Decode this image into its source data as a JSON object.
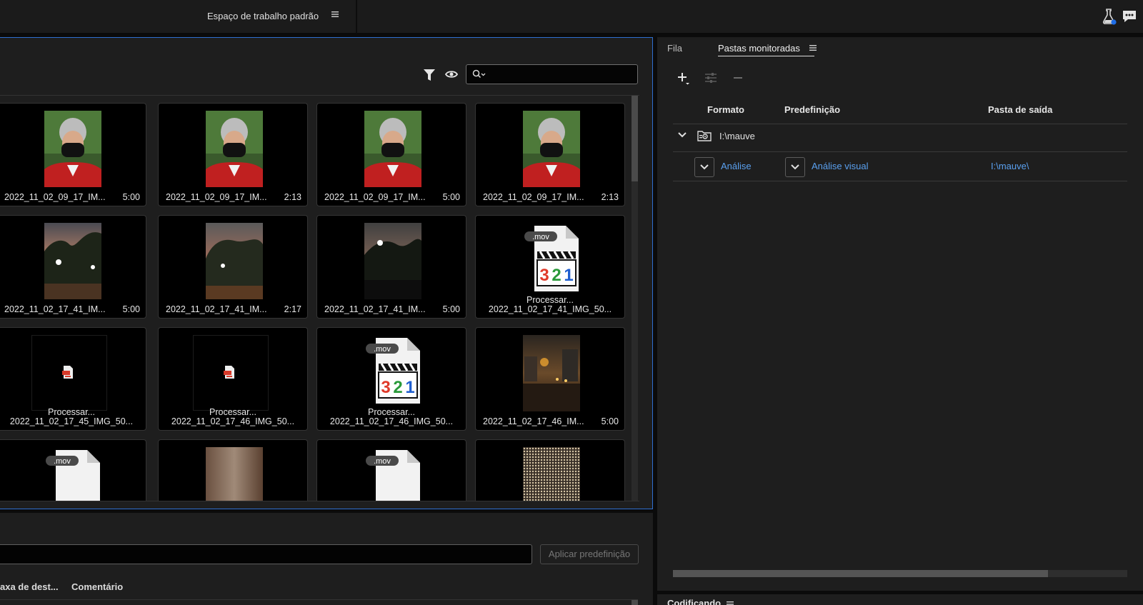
{
  "header": {
    "workspace_label": "Espaço de trabalho padrão",
    "icons": [
      "workspace-menu-icon",
      "beta-lab-icon",
      "feedback-icon"
    ]
  },
  "browser": {
    "search": {
      "value": "",
      "placeholder": ""
    },
    "tiles": [
      {
        "name": "2022_11_02_09_17_IM...",
        "duration": "5:00",
        "kind": "photo-portrait"
      },
      {
        "name": "2022_11_02_09_17_IM...",
        "duration": "2:13",
        "kind": "photo-portrait"
      },
      {
        "name": "2022_11_02_09_17_IM...",
        "duration": "5:00",
        "kind": "photo-portrait"
      },
      {
        "name": "2022_11_02_09_17_IM...",
        "duration": "2:13",
        "kind": "photo-portrait"
      },
      {
        "name": "2022_11_02_17_41_IM...",
        "duration": "5:00",
        "kind": "photo-dusk"
      },
      {
        "name": "2022_11_02_17_41_IM...",
        "duration": "2:17",
        "kind": "photo-dusk2"
      },
      {
        "name": "2022_11_02_17_41_IM...",
        "duration": "5:00",
        "kind": "photo-dusk3"
      },
      {
        "name": "2022_11_02_17_41_IMG_50...",
        "status": "Processar...",
        "kind": "mov-file",
        "ext": ".mov",
        "badge_digits": [
          "3",
          "2",
          "1"
        ]
      },
      {
        "name": "2022_11_02_17_45_IMG_50...",
        "status": "Processar...",
        "kind": "broken"
      },
      {
        "name": "2022_11_02_17_46_IMG_50...",
        "status": "Processar...",
        "kind": "broken"
      },
      {
        "name": "2022_11_02_17_46_IMG_50...",
        "status": "Processar...",
        "kind": "mov-file",
        "ext": ".mov",
        "badge_digits": [
          "3",
          "2",
          "1"
        ]
      },
      {
        "name": "2022_11_02_17_46_IM...",
        "duration": "5:00",
        "kind": "photo-night"
      },
      {
        "kind": "mov-file-partial",
        "ext": ".mov"
      },
      {
        "kind": "blur-partial"
      },
      {
        "kind": "mov-file-partial",
        "ext": ".mov"
      },
      {
        "kind": "mesh-partial"
      }
    ]
  },
  "lower_left": {
    "preset_input_value": "",
    "apply_button": "Aplicar predefinição",
    "columns": [
      "axa de dest...",
      "Comentário"
    ]
  },
  "right_panel": {
    "tabs": [
      {
        "label": "Fila",
        "active": false
      },
      {
        "label": "Pastas monitoradas",
        "active": true
      }
    ],
    "toolbar": [
      "add-icon",
      "settings-sliders-icon",
      "remove-icon"
    ],
    "columns": {
      "format": "Formato",
      "preset": "Predefinição",
      "output": "Pasta de saída"
    },
    "folder": {
      "path": "I:\\mauve"
    },
    "row": {
      "format": "Análise",
      "preset": "Análise visual",
      "output": "I:\\mauve\\"
    },
    "scroll_position": 0.83
  },
  "encoding_panel": {
    "label": "Codificando"
  },
  "colors": {
    "accent_blue": "#2f6fd0",
    "link_blue": "#5aa0ef",
    "panel_bg": "#1e1e1e"
  }
}
